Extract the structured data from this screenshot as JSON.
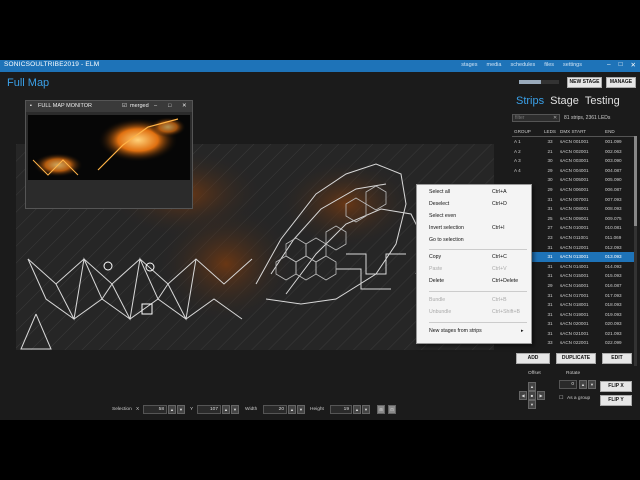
{
  "window": {
    "title": "SONICSOULTRIBE2019 - ELM",
    "controls": [
      "–",
      "□",
      "✕"
    ]
  },
  "topnav": [
    "stages",
    "media",
    "schedules",
    "files",
    "settings"
  ],
  "page_title": "Full Map",
  "zoom_level": 0.55,
  "buttons": {
    "new_stage": "NEW STAGE",
    "manage": "MANAGE",
    "add": "ADD",
    "duplicate": "DUPLICATE",
    "edit": "EDIT",
    "flip_x": "FLIP X",
    "flip_y": "FLIP Y"
  },
  "tabs": [
    "Strips",
    "Stage",
    "Testing"
  ],
  "active_tab": "Strips",
  "filter": {
    "placeholder": "filter",
    "count": "81 strips, 2361 LEDs"
  },
  "table": {
    "headers": [
      "GROUP",
      "LEDS",
      "DMX START",
      "END"
    ],
    "rows": [
      [
        "A 1",
        "33",
        "sACN 001001",
        "001.099"
      ],
      [
        "A 2",
        "21",
        "sACN 002001",
        "002.063"
      ],
      [
        "A 3",
        "30",
        "sACN 003001",
        "003.090"
      ],
      [
        "A 4",
        "29",
        "sACN 004001",
        "004.087"
      ],
      [
        "",
        "30",
        "sACN 005001",
        "005.090"
      ],
      [
        "",
        "29",
        "sACN 006001",
        "006.087"
      ],
      [
        "",
        "31",
        "sACN 007001",
        "007.093"
      ],
      [
        "",
        "31",
        "sACN 008001",
        "008.093"
      ],
      [
        "",
        "25",
        "sACN 009001",
        "009.075"
      ],
      [
        "",
        "27",
        "sACN 010001",
        "010.081"
      ],
      [
        "",
        "23",
        "sACN 011001",
        "011.069"
      ],
      [
        "",
        "31",
        "sACN 012001",
        "012.093"
      ],
      [
        "",
        "31",
        "sACN 013001",
        "013.093"
      ],
      [
        "",
        "31",
        "sACN 014001",
        "014.093"
      ],
      [
        "",
        "31",
        "sACN 015001",
        "015.093"
      ],
      [
        "",
        "29",
        "sACN 016001",
        "016.087"
      ],
      [
        "",
        "31",
        "sACN 017001",
        "017.093"
      ],
      [
        "",
        "31",
        "sACN 018001",
        "018.093"
      ],
      [
        "",
        "31",
        "sACN 019001",
        "019.093"
      ],
      [
        "",
        "31",
        "sACN 020001",
        "020.093"
      ],
      [
        "",
        "31",
        "sACN 021001",
        "021.093"
      ],
      [
        "",
        "33",
        "sACN 022001",
        "022.099"
      ]
    ],
    "selected_index": 12
  },
  "transform": {
    "offset_label": "Offset",
    "rotate_label": "Rotate",
    "rotate_value": "0",
    "as_group": "As a group"
  },
  "float_window": {
    "title": "FULL MAP MONITOR",
    "merged": "merged"
  },
  "context_menu": [
    {
      "label": "Select all",
      "shortcut": "Ctrl+A",
      "enabled": true
    },
    {
      "label": "Deselect",
      "shortcut": "Ctrl+D",
      "enabled": true
    },
    {
      "label": "Select even",
      "shortcut": "",
      "enabled": true
    },
    {
      "label": "Invert selection",
      "shortcut": "Ctrl+I",
      "enabled": true
    },
    {
      "label": "Go to selection",
      "shortcut": "",
      "enabled": true
    },
    {
      "label": "Copy",
      "shortcut": "Ctrl+C",
      "enabled": true
    },
    {
      "label": "Paste",
      "shortcut": "Ctrl+V",
      "enabled": false
    },
    {
      "label": "Delete",
      "shortcut": "Ctrl+Delete",
      "enabled": true
    },
    {
      "label": "Bundle",
      "shortcut": "Ctrl+B",
      "enabled": false
    },
    {
      "label": "Unbundle",
      "shortcut": "Ctrl+Shift+B",
      "enabled": false
    },
    {
      "label": "New stages from strips",
      "shortcut": "▸",
      "enabled": true
    }
  ],
  "selection": {
    "label": "Selection",
    "x_label": "X",
    "x": "58",
    "y_label": "Y",
    "y": "107",
    "width_label": "Width",
    "width": "20",
    "height_label": "Height",
    "height": "19"
  },
  "colors": {
    "accent": "#3aa0e8",
    "titlebar": "#1e73b8",
    "selected_row": "#1e73b8",
    "glow": "#ff9a1e"
  }
}
